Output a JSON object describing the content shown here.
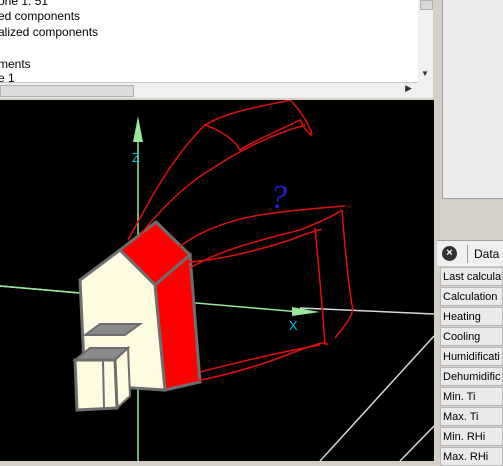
{
  "tree": {
    "rows": [
      "one 1: 51",
      "ed components",
      "alized components",
      "",
      "ments",
      "e 1"
    ]
  },
  "view": {
    "axis_z_label": "Z",
    "axis_x_label": "X",
    "annotation": "?"
  },
  "panel": {
    "tab_label": "Data",
    "rows": [
      "Last calculat",
      "Calculation",
      "Heating",
      "Cooling",
      "Humidificati",
      "Dehumidific",
      "Min. Ti",
      "Max. Ti",
      "Min. RHi",
      "Max. RHi"
    ]
  },
  "colors": {
    "viewport_bg": "#000000",
    "roof": "#ff0000",
    "wall": "#fffbe0",
    "axis_green": "#98e898",
    "axis_label": "#00c0e0",
    "annotation": "#e01010"
  }
}
